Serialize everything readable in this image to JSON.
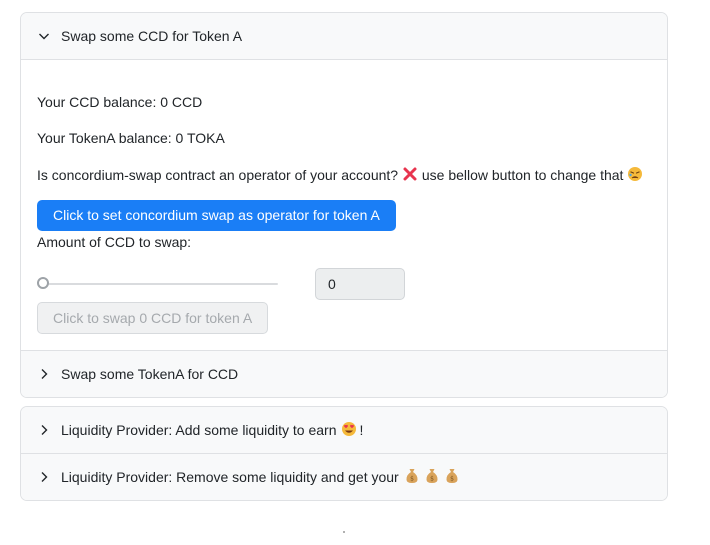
{
  "accordion1": {
    "header_open": "Swap some CCD for Token A",
    "header_closed": "Swap some TokenA for CCD",
    "body": {
      "ccd_balance": "Your CCD balance: 0 CCD",
      "token_balance": "Your TokenA balance: 0 TOKA",
      "operator_question": "Is concordium-swap contract an operator of your account?",
      "operator_status_icon": "cross-mark",
      "operator_hint": "use bellow button to change that",
      "hint_emoji": "tired-face",
      "set_operator_button": "Click to set concordium swap as operator for token A",
      "amount_label": "Amount of CCD to swap:",
      "slider_value": 0,
      "amount_value": "0",
      "swap_button": "Click to swap 0 CCD for token A"
    }
  },
  "accordion2": {
    "add_liquidity": "Liquidity Provider: Add some liquidity to earn",
    "add_liquidity_suffix": "!",
    "add_emoji": "heart-eyes",
    "remove_liquidity": "Liquidity Provider: Remove some liquidity and get your",
    "money_emoji": "money-bag"
  },
  "colors": {
    "primary": "#1a7ef6",
    "cross": "#e8344e"
  }
}
